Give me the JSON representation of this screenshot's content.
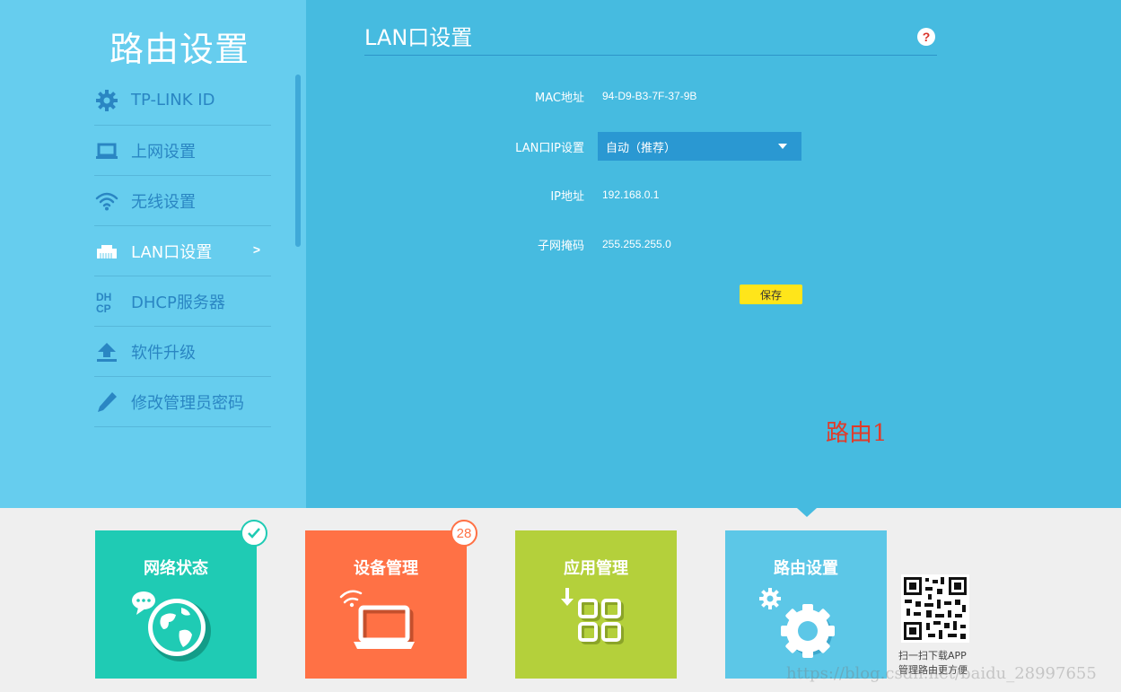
{
  "sidebar": {
    "title": "路由设置",
    "items": [
      {
        "label": "TP-LINK ID",
        "icon": "gear-icon"
      },
      {
        "label": "上网设置",
        "icon": "laptop-icon"
      },
      {
        "label": "无线设置",
        "icon": "wifi-icon"
      },
      {
        "label": "LAN口设置",
        "icon": "ethernet-port-icon",
        "active": true,
        "arrow": ">"
      },
      {
        "label": "DHCP服务器",
        "icon": "dhcp-icon"
      },
      {
        "label": "软件升级",
        "icon": "upload-icon"
      },
      {
        "label": "修改管理员密码",
        "icon": "pencil-icon"
      }
    ]
  },
  "content": {
    "title": "LAN口设置",
    "help": "?",
    "mac_label": "MAC地址",
    "mac_value": "94-D9-B3-7F-37-9B",
    "lanip_label": "LAN口IP设置",
    "lanip_value": "自动（推荐）",
    "ip_label": "IP地址",
    "ip_value": "192.168.0.1",
    "mask_label": "子网掩码",
    "mask_value": "255.255.255.0",
    "save": "保存"
  },
  "annotation": "路由1",
  "tiles": {
    "net": "网络状态",
    "dev": "设备管理",
    "dev_badge": "28",
    "app": "应用管理",
    "route": "路由设置"
  },
  "qr_caption": {
    "line1": "扫一扫下载APP",
    "line2": "管理路由更方便"
  },
  "watermark": "https://blog.csdn.net/baidu_28997655",
  "colors": {
    "sidebar": "#66cdee",
    "main": "#46bbe0",
    "save": "#ffe51a",
    "tile_net": "#1fcbb4",
    "tile_dev": "#ff7145",
    "tile_app": "#b4d03b",
    "tile_route": "#5cc7e7"
  }
}
